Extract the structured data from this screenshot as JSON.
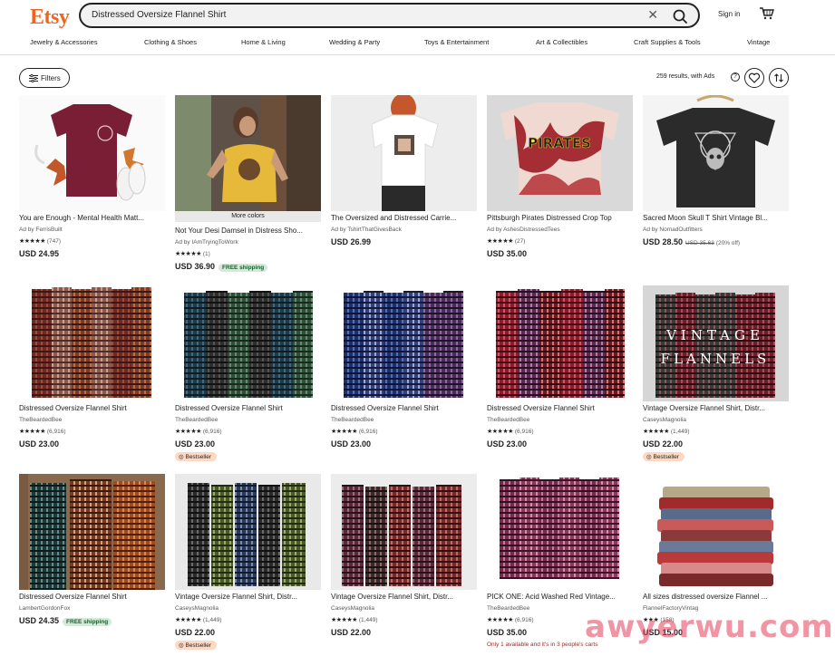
{
  "header": {
    "logo": "Etsy",
    "search_value": "Distressed Oversize Flannel Shirt",
    "signin_label": "Sign in"
  },
  "categories": [
    "Jewelry & Accessories",
    "Clothing & Shoes",
    "Home & Living",
    "Wedding & Party",
    "Toys & Entertainment",
    "Art & Collectibles",
    "Craft Supplies & Tools",
    "Vintage"
  ],
  "toolbar": {
    "filters_label": "Filters",
    "results_text": "259 results, with Ads",
    "help_glyph": "?"
  },
  "badges": {
    "more_colors": "More colors",
    "free_shipping": "FREE shipping",
    "bestseller": "Bestseller"
  },
  "listings": [
    {
      "title": "You are Enough - Mental Health Matt...",
      "shop": "Ad by FerrisBuilt",
      "stars": "★★★★★",
      "reviews": "(747)",
      "price": "USD 24.95"
    },
    {
      "title": "Not Your Desi Damsel in Distress Sho...",
      "shop": "Ad by IAmTryingToWork",
      "stars": "★★★★★",
      "reviews": "(1)",
      "price": "USD 36.90"
    },
    {
      "title": "The Oversized and Distressed Carrie...",
      "shop": "Ad by TshirtThatGivesBack",
      "stars": "",
      "reviews": "",
      "price": "USD 26.99"
    },
    {
      "title": "Pittsburgh Pirates Distressed Crop Top",
      "shop": "Ad by AshesDistressedTees",
      "stars": "★★★★★",
      "reviews": "(27)",
      "price": "USD 35.00"
    },
    {
      "title": "Sacred Moon Skull T Shirt Vintage Bl...",
      "shop": "Ad by NomadOutfitters",
      "stars": "",
      "reviews": "",
      "price": "USD 28.50",
      "original_price": "USD 35.63",
      "discount": "(20% off)"
    },
    {
      "title": "Distressed Oversize Flannel Shirt",
      "shop": "TheBeardedBee",
      "stars": "★★★★★",
      "reviews": "(6,916)",
      "price": "USD 23.00"
    },
    {
      "title": "Distressed Oversize Flannel Shirt",
      "shop": "TheBeardedBee",
      "stars": "★★★★★",
      "reviews": "(6,916)",
      "price": "USD 23.00"
    },
    {
      "title": "Distressed Oversize Flannel Shirt",
      "shop": "TheBeardedBee",
      "stars": "★★★★★",
      "reviews": "(6,916)",
      "price": "USD 23.00"
    },
    {
      "title": "Distressed Oversize Flannel Shirt",
      "shop": "TheBeardedBee",
      "stars": "★★★★★",
      "reviews": "(6,916)",
      "price": "USD 23.00"
    },
    {
      "title": "Vintage Oversize Flannel Shirt, Distr...",
      "shop": "CaseysMagnolia",
      "stars": "★★★★★",
      "reviews": "(1,449)",
      "price": "USD 22.00"
    },
    {
      "title": "Distressed Oversize Flannel Shirt",
      "shop": "LambertGordonFox",
      "stars": "",
      "reviews": "",
      "price": "USD 24.35"
    },
    {
      "title": "Vintage Oversize Flannel Shirt, Distr...",
      "shop": "CaseysMagnolia",
      "stars": "★★★★★",
      "reviews": "(1,449)",
      "price": "USD 22.00"
    },
    {
      "title": "Vintage Oversize Flannel Shirt, Distr...",
      "shop": "CaseysMagnolia",
      "stars": "★★★★★",
      "reviews": "(1,449)",
      "price": "USD 22.00"
    },
    {
      "title": "PICK ONE: Acid Washed Red Vintage...",
      "shop": "TheBeardedBee",
      "stars": "★★★★★",
      "reviews": "(6,916)",
      "price": "USD 35.00",
      "stock": "Only 1 available and it's in 3 people's carts"
    },
    {
      "title": "All sizes distressed oversize Flannel ...",
      "shop": "FlannelFactoryVintag",
      "stars": "★★★",
      "reviews": "(158)",
      "price": "USD 15.00"
    }
  ],
  "image_text": {
    "pirates": "PIRATES",
    "vintage": "VINTAGE",
    "flannels": "FLANNELS"
  },
  "watermark": "awyerwu.com",
  "colors": {
    "brand": "#F1641E",
    "free_shipping_bg": "#d4e9d7",
    "bestseller_bg": "#fdd9c3"
  }
}
